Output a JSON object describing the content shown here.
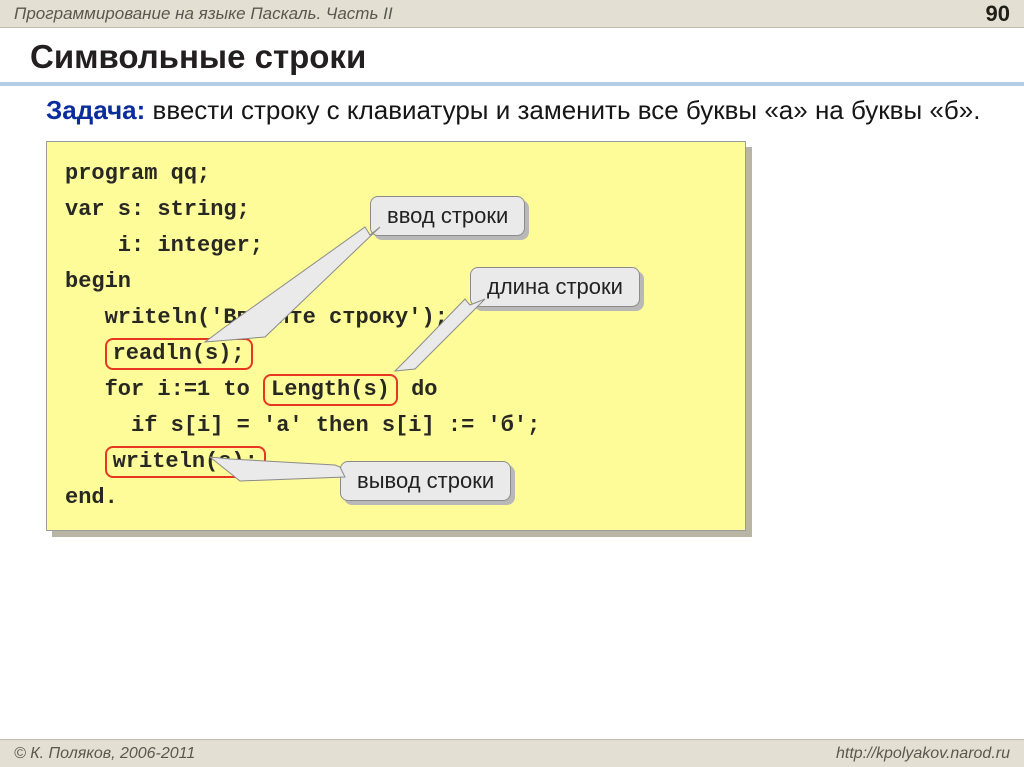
{
  "header": {
    "title": "Программирование на языке Паскаль. Часть II",
    "page_number": "90"
  },
  "title": "Символьные строки",
  "task": {
    "label": "Задача:",
    "text": " ввести строку с клавиатуры и заменить все буквы «а» на буквы «б»."
  },
  "code": {
    "l1": "program qq;",
    "l2": "var s: string;",
    "l3": "    i: integer;",
    "l4": "begin",
    "l5_a": "   writeln('Введите строку');",
    "l6_pre": "   ",
    "l6_hl": "readln(s);",
    "l7_a": "   for i:=1 to ",
    "l7_hl": "Length(s)",
    "l7_b": " do",
    "l8": "     if s[i] = 'а' then s[i] := 'б';",
    "l9_pre": "   ",
    "l9_hl": "writeln(s);",
    "l10": "end."
  },
  "callouts": {
    "c1": "ввод строки",
    "c2": "длина строки",
    "c3": "вывод строки"
  },
  "footer": {
    "left": "© К. Поляков, 2006-2011",
    "right": "http://kpolyakov.narod.ru"
  }
}
